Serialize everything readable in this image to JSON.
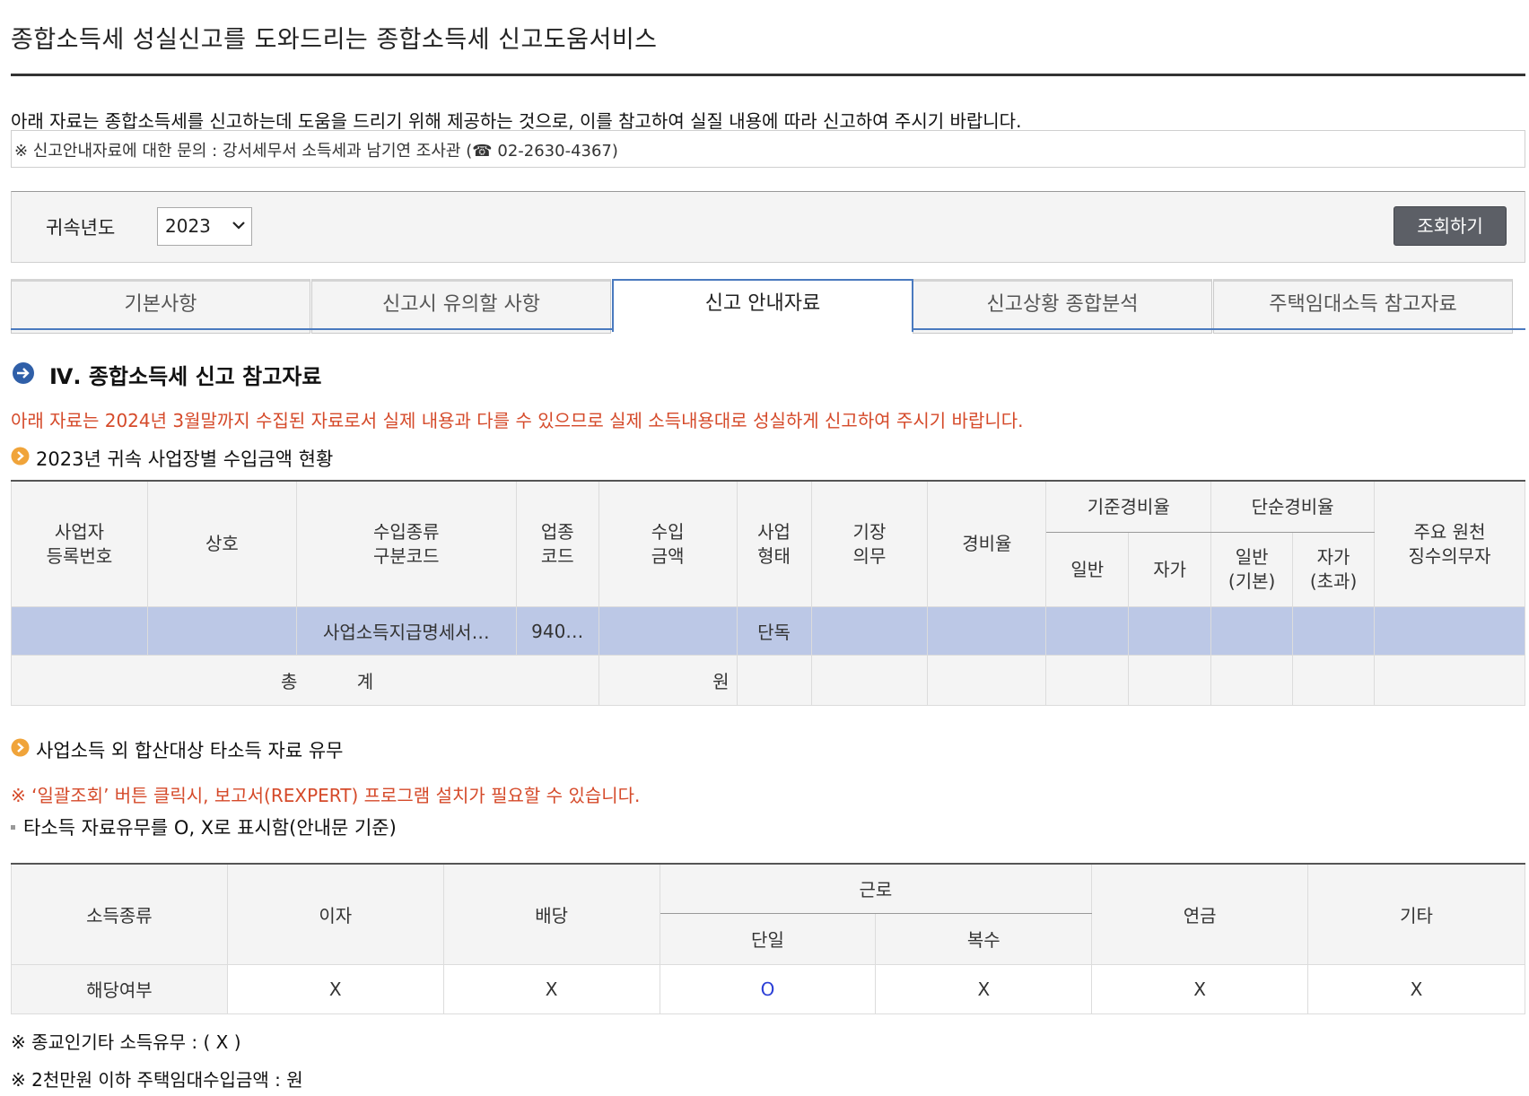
{
  "header": {
    "title": "종합소득세 성실신고를 도와드리는 종합소득세 신고도움서비스",
    "intro": "아래 자료는 종합소득세를 신고하는데 도움을 드리기 위해 제공하는 것으로, 이를 참고하여 실질 내용에 따라 신고하여 주시기 바랍니다.",
    "notice": "※ 신고안내자료에 대한 문의 : 강서세무서 소득세과 남기연 조사관 (☎ 02-2630-4367)"
  },
  "search": {
    "year_label": "귀속년도",
    "year_value": "2023",
    "button_label": "조회하기"
  },
  "tabs": [
    {
      "label": "기본사항",
      "active": false
    },
    {
      "label": "신고시 유의할 사항",
      "active": false
    },
    {
      "label": "신고 안내자료",
      "active": true
    },
    {
      "label": "신고상황 종합분석",
      "active": false
    },
    {
      "label": "주택임대소득 참고자료",
      "active": false
    }
  ],
  "section": {
    "title": "Ⅳ. 종합소득세 신고 참고자료",
    "red_note": "아래 자료는 2024년 3월말까지 수집된 자료로서 실제 내용과 다를 수 있으므로 실제 소득내용대로 성실하게 신고하여 주시기 바랍니다."
  },
  "income_table": {
    "title": "2023년 귀속 사업장별 수입금액 현황",
    "headers": {
      "reg_no": "사업자\n등록번호",
      "name": "상호",
      "income_type": "수입종류\n구분코드",
      "industry": "업종\n코드",
      "amount": "수입\n금액",
      "biz_type": "사업\n형태",
      "bookkeeping": "기장\n의무",
      "expense_rate": "경비율",
      "std_rate": "기준경비율",
      "simple_rate": "단순경비율",
      "general": "일반",
      "self": "자가",
      "general_basic": "일반\n(기본)",
      "self_excess": "자가\n(초과)",
      "withholding": "주요 원천\n징수의무자"
    },
    "row": {
      "reg_no": "",
      "name": "",
      "income_type": "사업소득지급명세서…",
      "industry": "940…",
      "amount": "",
      "biz_type": "단독"
    },
    "total": {
      "label": "총 계",
      "amount_unit": "원"
    }
  },
  "other_income": {
    "title": "사업소득 외 합산대상 타소득 자료 유무",
    "red_note": "※ ‘일괄조회’ 버튼 클릭시, 보고서(REXPERT) 프로그램 설치가 필요할 수 있습니다.",
    "legend": "타소득 자료유무를 O, X로 표시함(안내문 기준)",
    "headers": {
      "kind": "소득종류",
      "interest": "이자",
      "dividend": "배당",
      "labor": "근로",
      "single": "단일",
      "multiple": "복수",
      "pension": "연금",
      "other": "기타"
    },
    "row_label": "해당여부",
    "values": {
      "interest": "X",
      "dividend": "X",
      "single": "O",
      "multiple": "X",
      "pension": "X",
      "other": "X"
    }
  },
  "footnotes": {
    "religious": "※ 종교인기타 소득유무 : ( X )",
    "rental": "※ 2천만원 이하 주택임대수입금액 : 원"
  },
  "colors": {
    "accent_blue": "#4a7abf",
    "highlight_row": "#bcc8e6",
    "red_note": "#d54a2a",
    "button": "#5c5f66",
    "bullet_orange": "#f0a43a"
  }
}
